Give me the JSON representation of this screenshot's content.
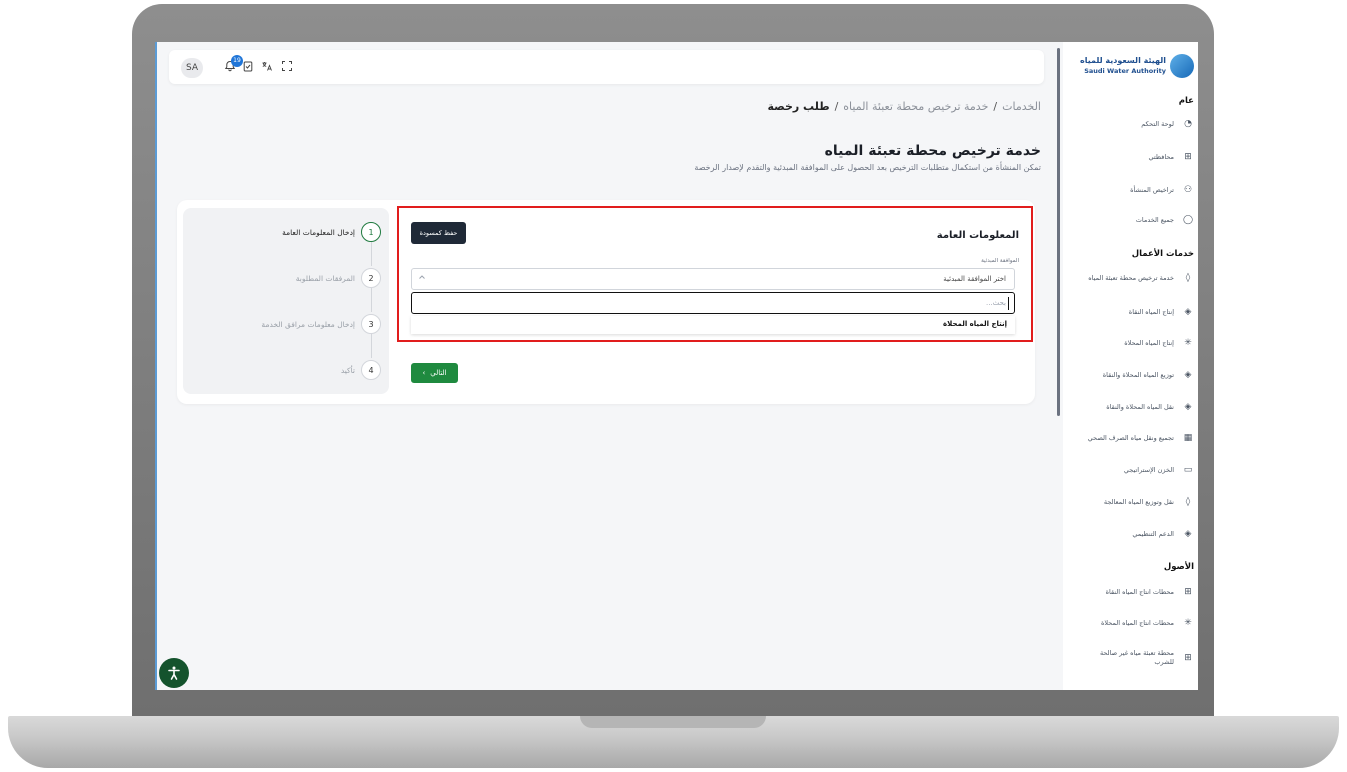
{
  "topbar": {
    "avatar_initials": "SA",
    "notification_count": "19",
    "icons": [
      "notification-bell-icon",
      "clipboard-check-icon",
      "translate-icon",
      "fullscreen-icon"
    ]
  },
  "breadcrumb": {
    "items": [
      "الخدمات",
      "خدمة ترخيص محطة تعبئة المياه"
    ],
    "current": "طلب رخصة",
    "separator": "/"
  },
  "page": {
    "title": "خدمة ترخيص محطة تعبئة المياه",
    "description": "تمكن المنشأة من استكمال متطلبات الترخيص بعد الحصول على الموافقة المبدئية والتقدم لإصدار الرخصة"
  },
  "stepper": {
    "steps": [
      {
        "number": "1",
        "label": "إدخال المعلومات العامة"
      },
      {
        "number": "2",
        "label": "المرفقات المطلوبة"
      },
      {
        "number": "3",
        "label": "إدخال معلومات مرافق الخدمة"
      },
      {
        "number": "4",
        "label": "تأكيد"
      }
    ]
  },
  "form": {
    "section_title": "المعلومات العامة",
    "save_draft_label": "حفظ كمسودة",
    "field_label": "الموافقة المبدئية",
    "select_value": "اختر الموافقة المبدئية",
    "search_placeholder": "بحث...",
    "options": [
      "إنتاج المياه المحلاة"
    ],
    "next_label": "التالي",
    "next_arrow": "›"
  },
  "sidebar": {
    "logo_ar": "الهيئة السعودية للمياه",
    "logo_en": "Saudi Water Authority",
    "groups": [
      {
        "title": "عام",
        "items": [
          {
            "label": "لوحة التحكم",
            "icon": "◔"
          },
          {
            "label": "محافظتي",
            "icon": "⊞"
          },
          {
            "label": "تراخيص المنشأة",
            "icon": "⚇"
          },
          {
            "label": "جميع الخدمات",
            "icon": "◯"
          }
        ]
      },
      {
        "title": "خدمات الأعمال",
        "items": [
          {
            "label": "خدمة ترخيص محطة تعبئة المياه",
            "icon": "◊"
          },
          {
            "label": "إنتاج المياه النقاة",
            "icon": "◈"
          },
          {
            "label": "إنتاج المياه المحلاة",
            "icon": "✳"
          },
          {
            "label": "توزيع المياه المحلاة والنقاة",
            "icon": "◈"
          },
          {
            "label": "نقل المياه المحلاة والنقاة",
            "icon": "◈"
          },
          {
            "label": "تجميع ونقل مياه الصرف الصحي",
            "icon": "▦"
          },
          {
            "label": "الخزن الإستراتيجي",
            "icon": "▭"
          },
          {
            "label": "نقل وتوزيع المياه المعالجة",
            "icon": "◊"
          },
          {
            "label": "الدعم التنظيمي",
            "icon": "◈"
          }
        ]
      },
      {
        "title": "الأصول",
        "items": [
          {
            "label": "محطات انتاج المياه النقاة",
            "icon": "⊞"
          },
          {
            "label": "محطات انتاج المياه المحلاة",
            "icon": "✳"
          },
          {
            "label": "محطة تعبئة مياه غير صالحة للشرب",
            "icon": "⊞"
          }
        ]
      }
    ]
  },
  "accessibility": {
    "icon": "accessibility-icon",
    "glyph": "✝"
  },
  "colors": {
    "primary_green": "#1f8a3f",
    "highlight_red": "#e11d1d",
    "dark_button": "#1f2937"
  }
}
